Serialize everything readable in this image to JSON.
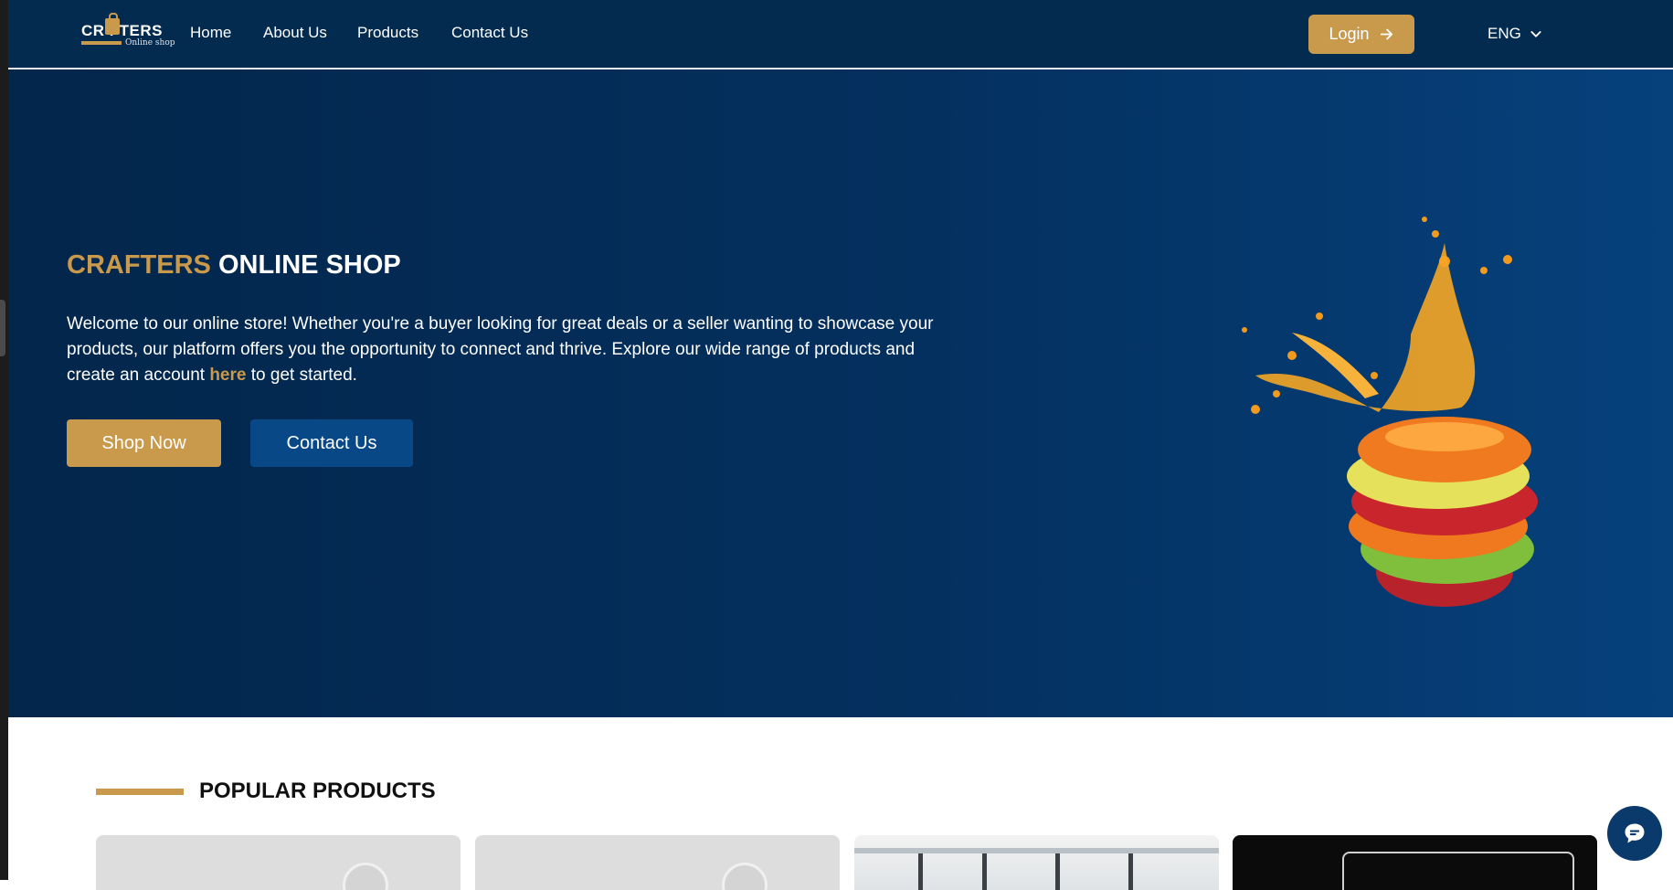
{
  "brand": {
    "logo_word": "CR  FTERS",
    "logo_tagline": "Online shop"
  },
  "nav": {
    "links": [
      {
        "label": "Home"
      },
      {
        "label": "About Us"
      },
      {
        "label": "Products"
      },
      {
        "label": "Contact Us"
      }
    ],
    "login_label": "Login",
    "language": "ENG"
  },
  "hero": {
    "title_part1": "CRAFTERS",
    "title_part2": "ONLINE SHOP",
    "desc_before": "Welcome to our online store! Whether you're a buyer looking for great deals or a seller wanting to showcase your products, our platform offers you the opportunity to connect and thrive. Explore our wide range of products and create an account ",
    "desc_link": "here",
    "desc_after": " to get started.",
    "shop_now_label": "Shop Now",
    "contact_label": "Contact Us"
  },
  "popular": {
    "title": "POPULAR PRODUCTS"
  },
  "icons": {
    "login": "arrow-right-icon",
    "language": "chevron-down-icon",
    "chat": "chat-bubble-icon"
  },
  "colors": {
    "accent": "#c9994c",
    "navy": "#032a4f",
    "secondary_button": "#084887"
  }
}
